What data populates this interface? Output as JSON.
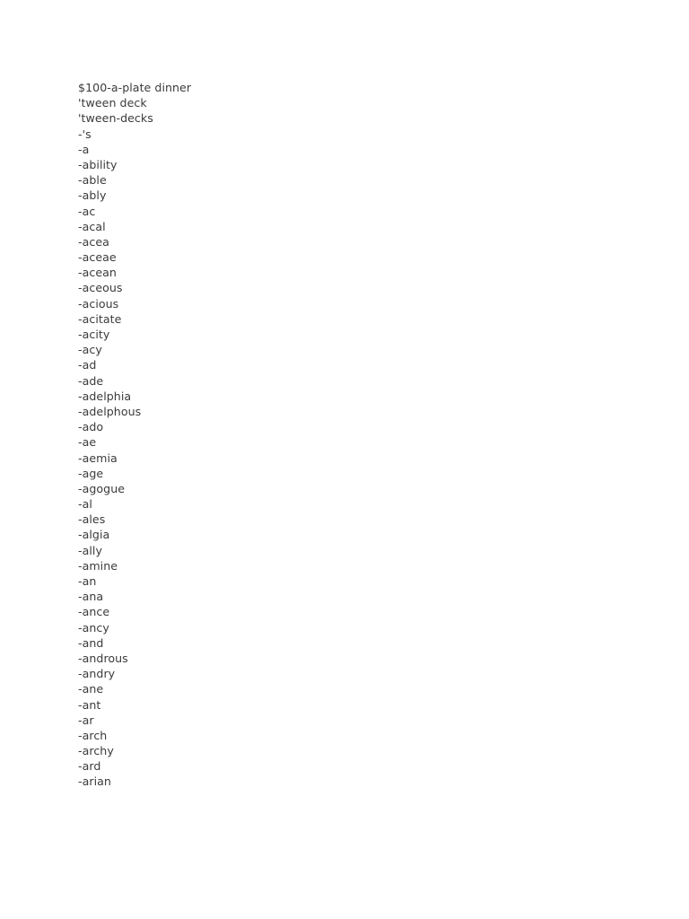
{
  "document": {
    "page_background": "#ffffff",
    "text_color": "#3b3b3b",
    "entries": [
      "$100-a-plate dinner",
      "'tween deck",
      "'tween-decks",
      "-'s",
      "-a",
      "-ability",
      "-able",
      "-ably",
      "-ac",
      "-acal",
      "-acea",
      "-aceae",
      "-acean",
      "-aceous",
      "-acious",
      "-acitate",
      "-acity",
      "-acy",
      "-ad",
      "-ade",
      "-adelphia",
      "-adelphous",
      "-ado",
      "-ae",
      "-aemia",
      "-age",
      "-agogue",
      "-al",
      "-ales",
      "-algia",
      "-ally",
      "-amine",
      "-an",
      "-ana",
      "-ance",
      "-ancy",
      "-and",
      "-androus",
      "-andry",
      "-ane",
      "-ant",
      "-ar",
      "-arch",
      "-archy",
      "-ard",
      "-arian"
    ]
  }
}
